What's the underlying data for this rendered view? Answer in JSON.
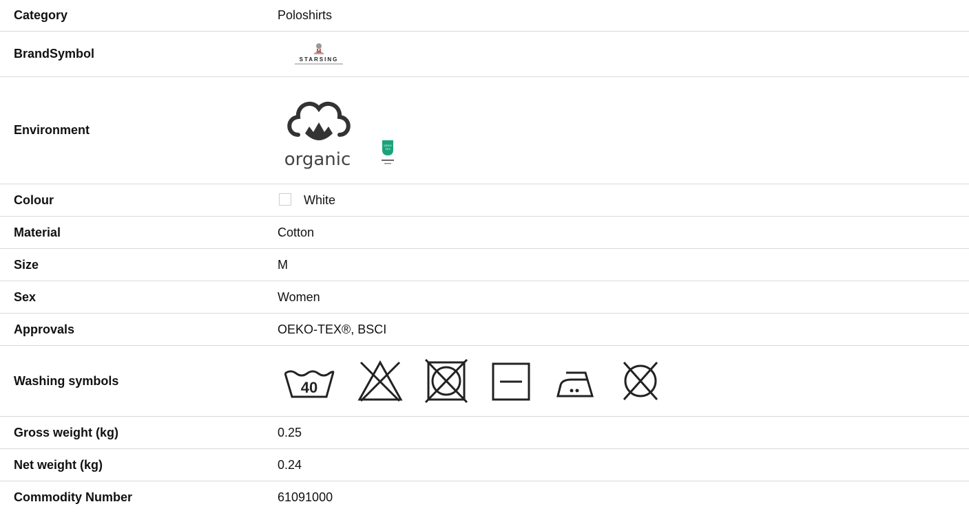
{
  "rows": {
    "category": {
      "label": "Category",
      "value": "Poloshirts"
    },
    "brand": {
      "label": "BrandSymbol",
      "logo_text": "STARSING",
      "logo_icon": "brand-logo"
    },
    "environment": {
      "label": "Environment",
      "organic_text": "organic",
      "organic_icon": "cotton-flower-icon",
      "oeko_icon": "oeko-tex-icon",
      "oeko_color": "#1aa37a"
    },
    "colour": {
      "label": "Colour",
      "value": "White",
      "swatch_color": "#ffffff"
    },
    "material": {
      "label": "Material",
      "value": "Cotton"
    },
    "size": {
      "label": "Size",
      "value": "M"
    },
    "sex": {
      "label": "Sex",
      "value": "Women"
    },
    "approvals": {
      "label": "Approvals",
      "value": "OEKO-TEX®, BSCI"
    },
    "washing": {
      "label": "Washing symbols",
      "temp": "40",
      "icons": [
        "wash-40-icon",
        "no-bleach-icon",
        "no-tumble-dry-icon",
        "line-dry-icon",
        "iron-medium-icon",
        "no-dry-clean-icon"
      ]
    },
    "gross_weight": {
      "label": "Gross weight (kg)",
      "value": "0.25"
    },
    "net_weight": {
      "label": "Net weight (kg)",
      "value": "0.24"
    },
    "commodity": {
      "label": "Commodity Number",
      "value": "61091000"
    }
  }
}
